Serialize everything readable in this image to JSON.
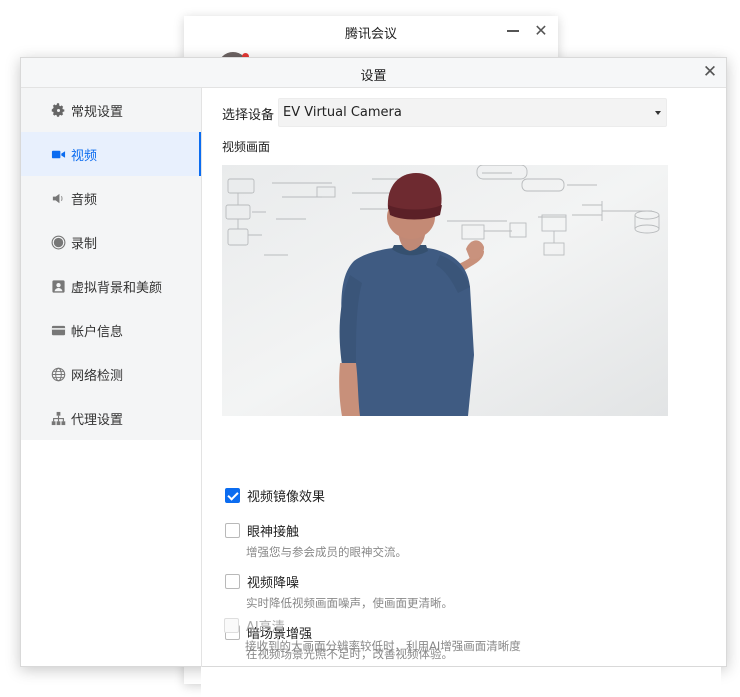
{
  "background_window": {
    "title": "腾讯会议"
  },
  "dialog": {
    "title": "设置"
  },
  "sidebar": {
    "items": [
      {
        "label": "常规设置",
        "icon": "gear-icon",
        "active": false
      },
      {
        "label": "视频",
        "icon": "video-camera-icon",
        "active": true
      },
      {
        "label": "音频",
        "icon": "speaker-icon",
        "active": false
      },
      {
        "label": "录制",
        "icon": "record-icon",
        "active": false
      },
      {
        "label": "虚拟背景和美颜",
        "icon": "portrait-icon",
        "active": false
      },
      {
        "label": "帐户信息",
        "icon": "card-icon",
        "active": false
      },
      {
        "label": "网络检测",
        "icon": "globe-icon",
        "active": false
      },
      {
        "label": "代理设置",
        "icon": "network-icon",
        "active": false
      }
    ]
  },
  "video": {
    "device_label": "选择设备",
    "device_value": "EV Virtual Camera",
    "preview_label": "视频画面",
    "options": [
      {
        "label": "视频镜像效果",
        "checked": true,
        "disabled": false,
        "desc": ""
      },
      {
        "label": "眼神接触",
        "checked": false,
        "disabled": false,
        "desc": "增强您与参会成员的眼神交流。"
      },
      {
        "label": "视频降噪",
        "checked": false,
        "disabled": false,
        "desc": "实时降低视频画面噪声，使画面更清晰。"
      },
      {
        "label": "暗场景增强",
        "checked": false,
        "disabled": false,
        "desc": "在视频场景光照不足时，改善视频体验。"
      },
      {
        "label": "AI高清",
        "checked": false,
        "disabled": true,
        "desc": "接收到的大画面分辨率较低时，利用AI增强画面清晰度"
      }
    ]
  },
  "colors": {
    "accent": "#0b6cf0",
    "sidebar_bg": "#f4f5f6",
    "active_bg": "#e8f0fd"
  }
}
